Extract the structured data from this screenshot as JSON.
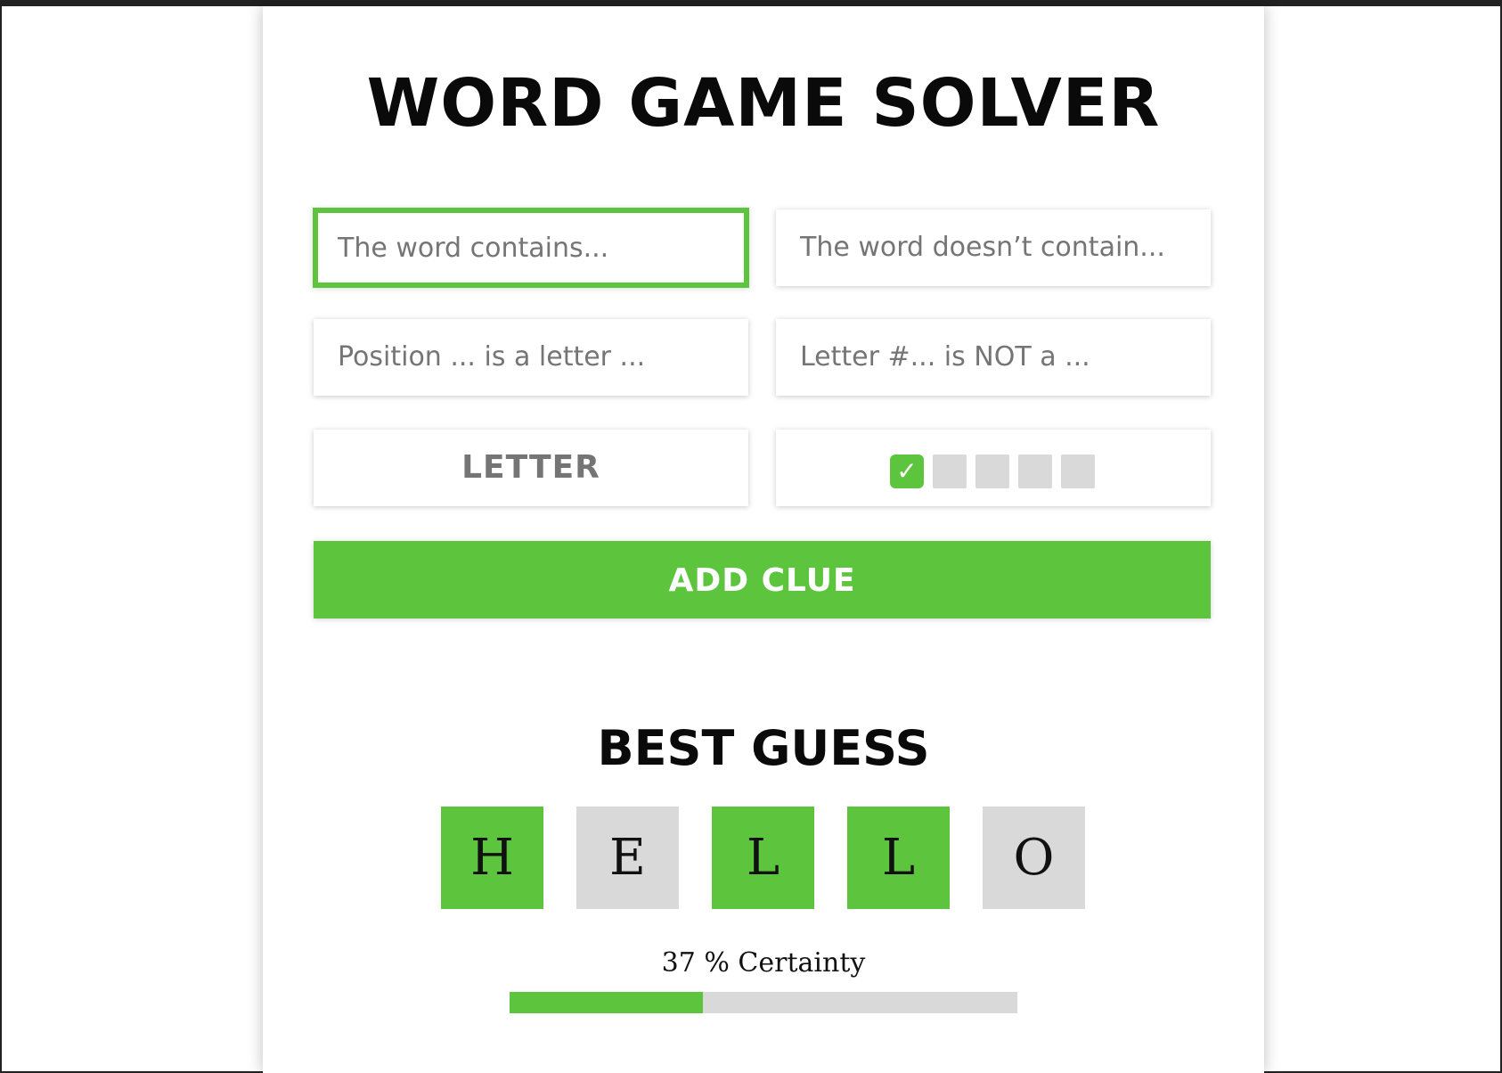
{
  "app": {
    "title": "WORD GAME SOLVER"
  },
  "clue_form": {
    "contains_placeholder": "The word contains...",
    "not_contains_placeholder": "The word doesn’t contain...",
    "position_placeholder": "Position ... is a letter ...",
    "not_position_placeholder": "Letter #... is NOT a ...",
    "letter_placeholder": "LETTER",
    "positions": [
      {
        "index": 1,
        "selected": true
      },
      {
        "index": 2,
        "selected": false
      },
      {
        "index": 3,
        "selected": false
      },
      {
        "index": 4,
        "selected": false
      },
      {
        "index": 5,
        "selected": false
      }
    ],
    "check_glyph": "✓",
    "add_clue_label": "ADD CLUE"
  },
  "best_guess": {
    "title": "BEST GUESS",
    "letters": [
      {
        "char": "H",
        "state": "match"
      },
      {
        "char": "E",
        "state": "none"
      },
      {
        "char": "L",
        "state": "match"
      },
      {
        "char": "L",
        "state": "match"
      },
      {
        "char": "O",
        "state": "none"
      }
    ],
    "certainty_text": "37 % Certainty",
    "certainty_percent": 38
  },
  "colors": {
    "accent": "#5dc43d",
    "tile_gray": "#d9d9d9",
    "placeholder_gray": "#b5b5b5"
  }
}
